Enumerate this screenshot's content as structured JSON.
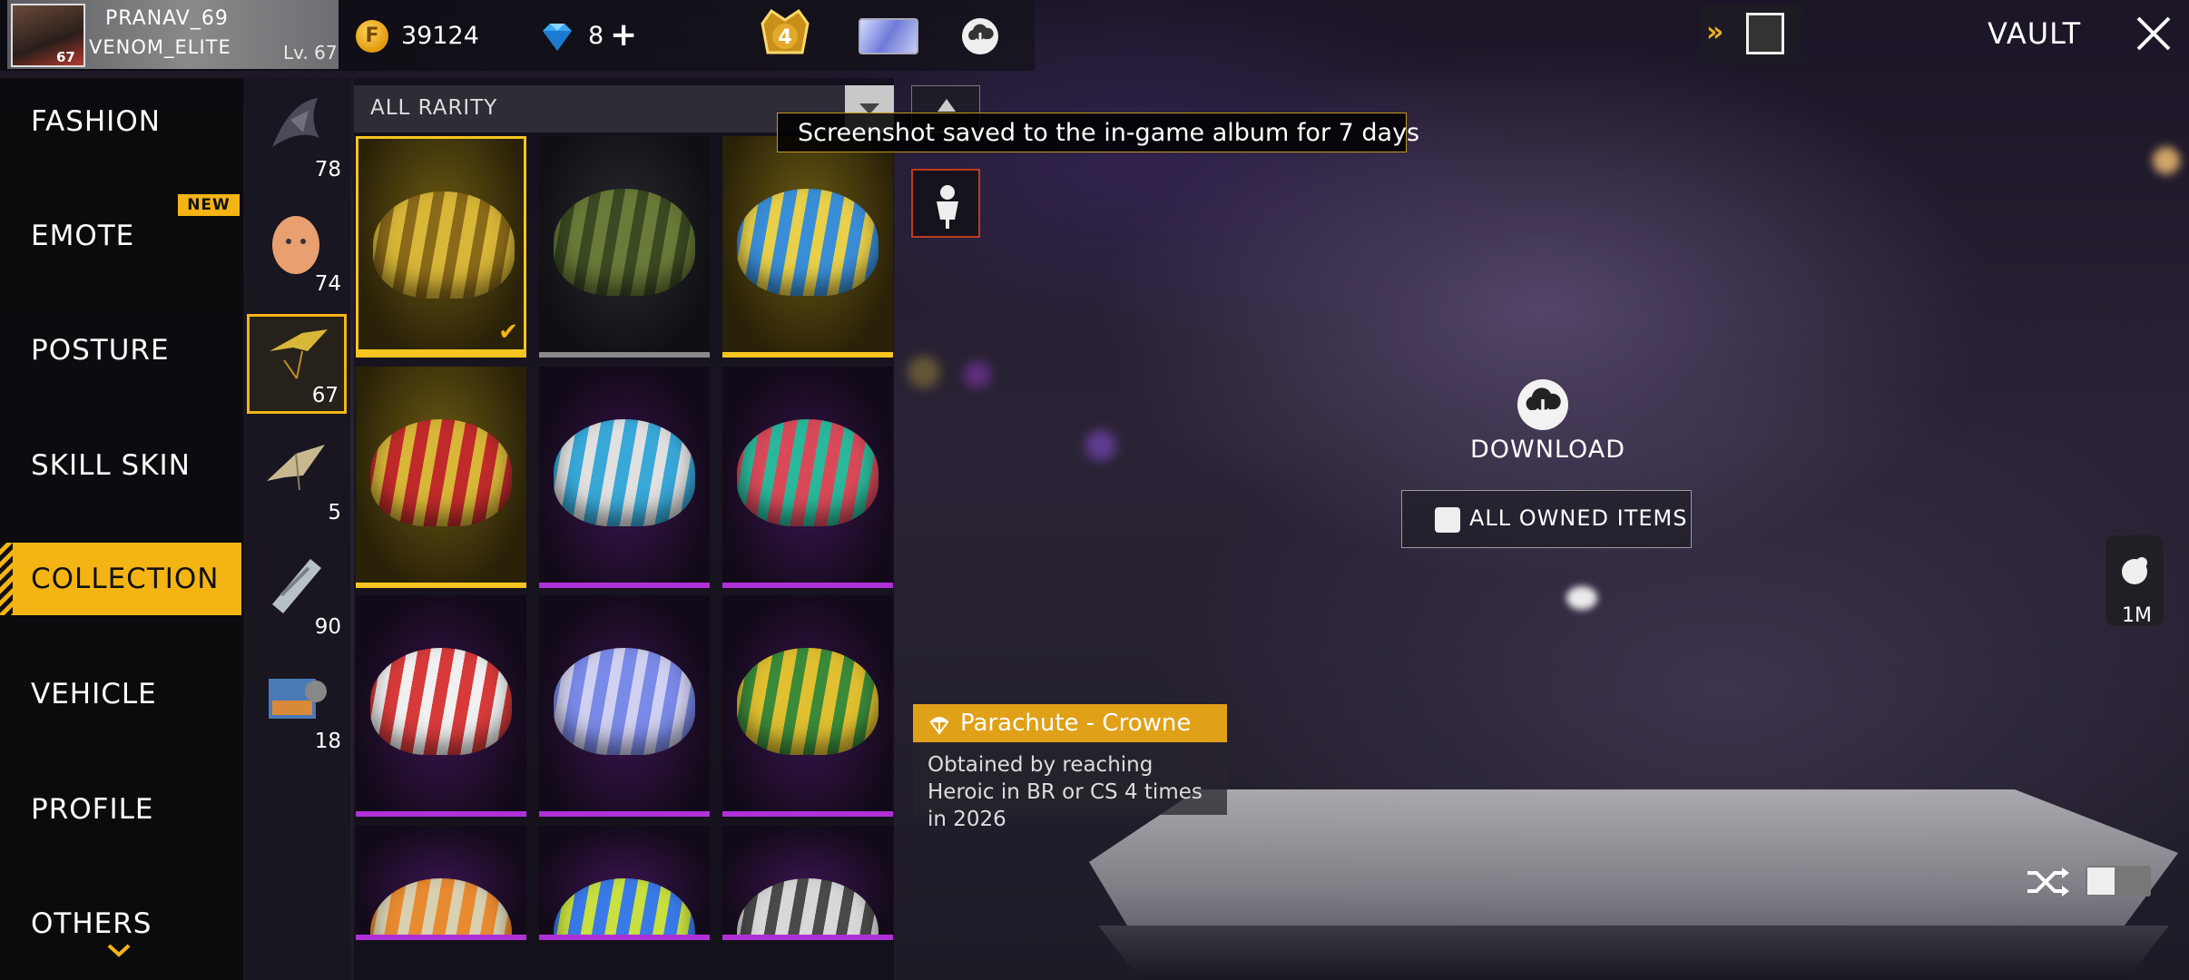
{
  "profile": {
    "name": "PRANAV_69",
    "guild": "VENOM_ELITE",
    "level_text": "Lv. 67",
    "avatar_level": "67"
  },
  "currency": {
    "gold_icon": "F",
    "gold": "39124",
    "diamonds": "8",
    "plus": "+"
  },
  "rank_badge": "4",
  "header": {
    "title": "VAULT"
  },
  "menu": {
    "items": [
      {
        "label": "FASHION"
      },
      {
        "label": "EMOTE"
      },
      {
        "label": "POSTURE"
      },
      {
        "label": "SKILL SKIN"
      },
      {
        "label": "COLLECTION"
      },
      {
        "label": "VEHICLE"
      },
      {
        "label": "PROFILE"
      },
      {
        "label": "OTHERS"
      }
    ],
    "new_badge": "NEW",
    "active": "COLLECTION"
  },
  "subcategories": [
    {
      "icon": "dragon-glider-icon",
      "count": "78"
    },
    {
      "icon": "egg-icon",
      "count": "74"
    },
    {
      "icon": "parachute-icon",
      "count": "67"
    },
    {
      "icon": "glider-icon",
      "count": "5"
    },
    {
      "icon": "skyboard-icon",
      "count": "90"
    },
    {
      "icon": "banner-icon",
      "count": "18"
    }
  ],
  "filter": {
    "rarity_label": "ALL RARITY"
  },
  "toast": {
    "text": "Screenshot saved to the in-game album for 7 days"
  },
  "grid": {
    "items": [
      {
        "rarity": "gold",
        "colors": [
          "#d8b638",
          "#8a6a1a"
        ],
        "selected": true
      },
      {
        "rarity": "grey",
        "colors": [
          "#6a7a38",
          "#3a4a22"
        ]
      },
      {
        "rarity": "gold",
        "colors": [
          "#3a8ed8",
          "#e8d04a"
        ]
      },
      {
        "rarity": "gold",
        "colors": [
          "#c02a2a",
          "#d8b638"
        ]
      },
      {
        "rarity": "purple",
        "colors": [
          "#38a8d8",
          "#e0e0e0"
        ]
      },
      {
        "rarity": "purple",
        "colors": [
          "#d84a5a",
          "#2ab89a"
        ]
      },
      {
        "rarity": "purple",
        "colors": [
          "#d83a3a",
          "#f0f0f0"
        ]
      },
      {
        "rarity": "purple",
        "colors": [
          "#7a8ae8",
          "#d0d0f0"
        ]
      },
      {
        "rarity": "purple",
        "colors": [
          "#e0c030",
          "#3a8a3a"
        ]
      },
      {
        "rarity": "purple",
        "colors": [
          "#e88a30",
          "#d8d0b0"
        ]
      },
      {
        "rarity": "purple",
        "colors": [
          "#3a7ae8",
          "#c8e040"
        ]
      },
      {
        "rarity": "purple",
        "colors": [
          "#d8d8d8",
          "#4a4a4a"
        ]
      }
    ]
  },
  "download": {
    "label": "DOWNLOAD",
    "owned_label": "ALL OWNED ITEMS"
  },
  "item_info": {
    "title": "Parachute - Crowne",
    "description": "Obtained by reaching Heroic in BR or CS 4 times in 2026"
  },
  "side": {
    "count": "1M"
  },
  "colors": {
    "accent": "#f4b414",
    "rarity_gold": "#f6c520",
    "rarity_purple": "#b030d8",
    "rarity_grey": "#8a8a8a"
  }
}
